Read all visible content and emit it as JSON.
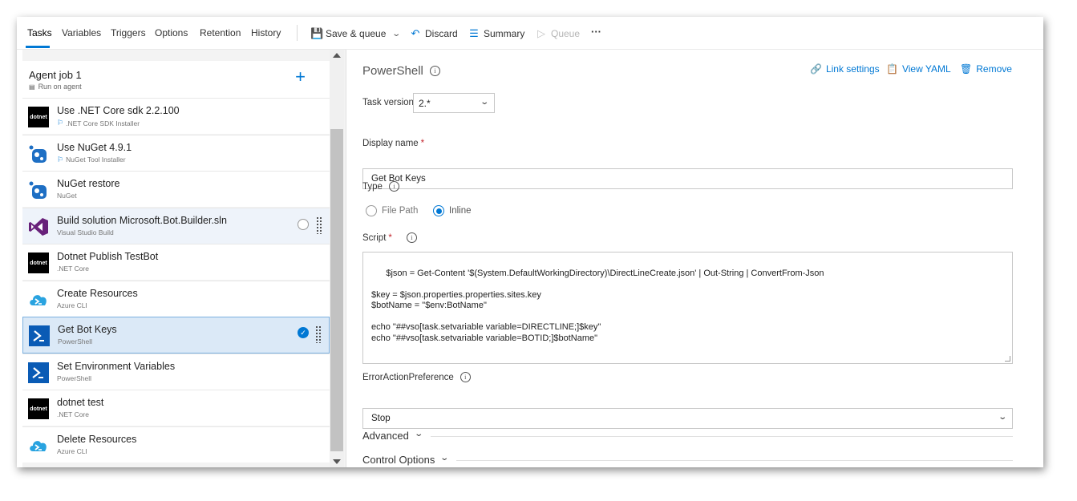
{
  "toolbar": {
    "tabs": [
      "Tasks",
      "Variables",
      "Triggers",
      "Options",
      "Retention",
      "History"
    ],
    "save_queue": "Save & queue",
    "discard": "Discard",
    "summary": "Summary",
    "queue": "Queue",
    "more": "···"
  },
  "agent_job": {
    "title": "Agent job 1",
    "subtitle": "Run on agent"
  },
  "tasks": [
    {
      "title": "Use .NET Core sdk 2.2.100",
      "subtitle": ".NET Core SDK Installer",
      "icon": "dotnet-icon",
      "flag": true
    },
    {
      "title": "Use NuGet 4.9.1",
      "subtitle": "NuGet Tool Installer",
      "icon": "nuget-icon",
      "flag": true
    },
    {
      "title": "NuGet restore",
      "subtitle": "NuGet",
      "icon": "nuget-icon",
      "flag": false
    },
    {
      "title": "Build solution Microsoft.Bot.Builder.sln",
      "subtitle": "Visual Studio Build",
      "icon": "visual-studio-icon",
      "flag": false
    },
    {
      "title": "Dotnet Publish TestBot",
      "subtitle": ".NET Core",
      "icon": "dotnet-icon",
      "flag": false
    },
    {
      "title": "Create Resources",
      "subtitle": "Azure CLI",
      "icon": "azure-cli-icon",
      "flag": false
    },
    {
      "title": "Get Bot Keys",
      "subtitle": "PowerShell",
      "icon": "powershell-icon",
      "flag": false
    },
    {
      "title": "Set Environment Variables",
      "subtitle": "PowerShell",
      "icon": "powershell-icon",
      "flag": false
    },
    {
      "title": "dotnet test",
      "subtitle": ".NET Core",
      "icon": "dotnet-icon",
      "flag": false
    },
    {
      "title": "Delete Resources",
      "subtitle": "Azure CLI",
      "icon": "azure-cli-icon",
      "flag": false
    }
  ],
  "detail": {
    "title": "PowerShell",
    "link_settings": "Link settings",
    "view_yaml": "View YAML",
    "remove": "Remove",
    "task_version_label": "Task version",
    "task_version": "2.*",
    "display_name_label": "Display name",
    "display_name": "Get Bot Keys",
    "type_label": "Type",
    "type_options": [
      "File Path",
      "Inline"
    ],
    "type_selected": "Inline",
    "script_label": "Script",
    "script": "$json = Get-Content '$(System.DefaultWorkingDirectory)\\DirectLineCreate.json' | Out-String | ConvertFrom-Json\n\n$key = $json.properties.properties.sites.key\n$botName = \"$env:BotName\"\n\necho \"##vso[task.setvariable variable=DIRECTLINE;]$key\"\necho \"##vso[task.setvariable variable=BOTID;]$botName\"",
    "error_pref_label": "ErrorActionPreference",
    "error_pref_value": "Stop",
    "advanced": "Advanced",
    "control_options": "Control Options"
  },
  "colors": {
    "accent": "#0078d4",
    "selected_row": "#dbe9f7",
    "required": "#c4262e"
  }
}
